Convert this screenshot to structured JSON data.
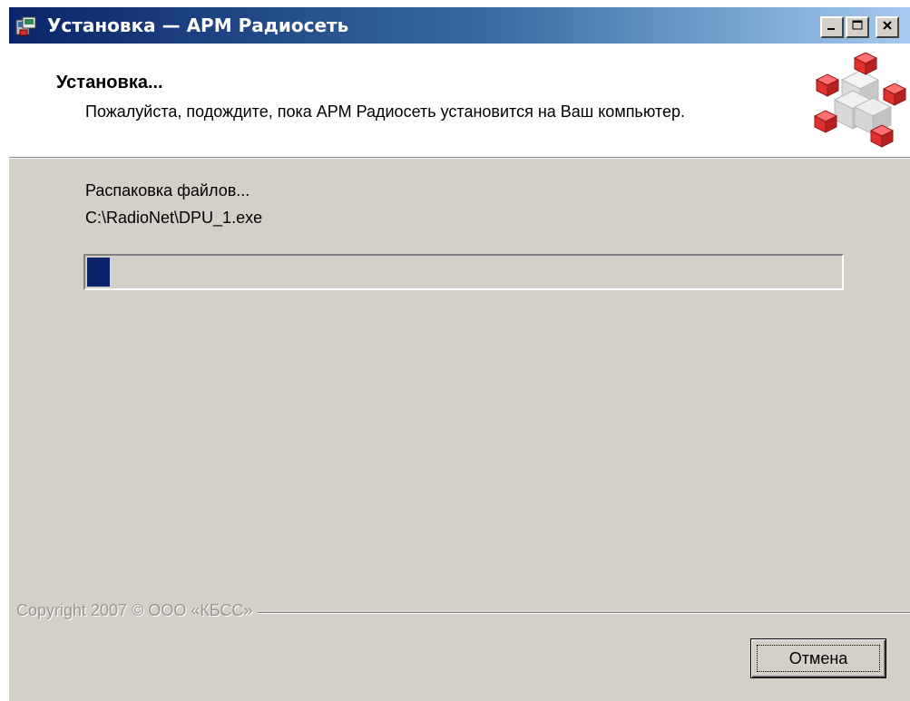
{
  "window": {
    "title": "Установка — АРМ Радиосеть"
  },
  "header": {
    "title": "Установка...",
    "description": "Пожалуйста, подождите, пока АРМ Радиосеть установится на Ваш компьютер."
  },
  "status": {
    "label": "Распаковка файлов...",
    "file": "C:\\RadioNet\\DPU_1.exe",
    "progress_fraction": 0.03
  },
  "footer": {
    "copyright": "Copyright 2007 © ООО «КБСС»",
    "cancel_label": "Отмена"
  },
  "icons": {
    "app": "installer-app-icon",
    "header": "cubes-graphic",
    "minimize": "minimize-icon",
    "maximize": "maximize-icon",
    "close": "close-icon"
  },
  "colors": {
    "titlebar_start": "#0a246a",
    "titlebar_end": "#a6caf0",
    "face": "#d4d0c8",
    "progress_fill": "#0a246a",
    "cube_red": "#e03030"
  }
}
